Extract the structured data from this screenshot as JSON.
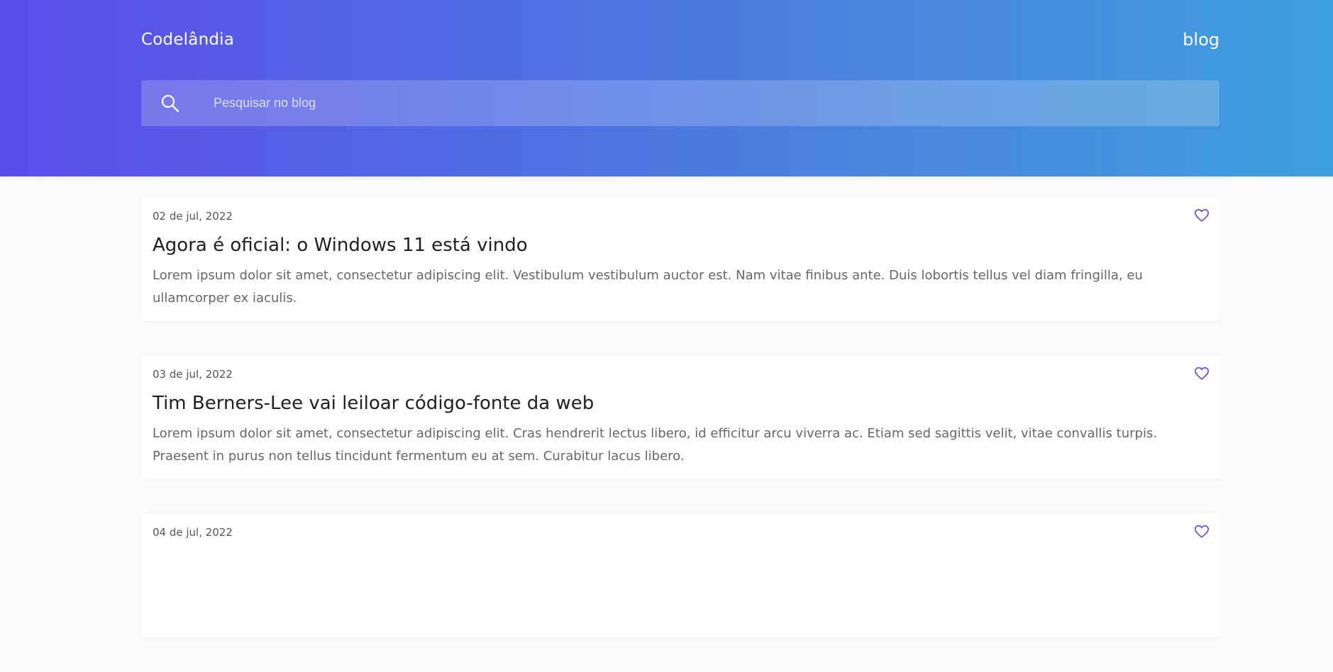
{
  "header": {
    "brand": "Codelândia",
    "nav_blog": "blog"
  },
  "search": {
    "placeholder": "Pesquisar no blog",
    "value": ""
  },
  "colors": {
    "gradient_start": "#5b4dea",
    "gradient_end": "#3d9fdc",
    "heart_accent": "#5b4dea",
    "page_bg": "#f9f9f9"
  },
  "icons": {
    "search": "search-icon",
    "like": "heart-outline-icon"
  },
  "posts": [
    {
      "date": "02 de jul, 2022",
      "title": "Agora é oficial: o Windows 11 está vindo",
      "excerpt": "Lorem ipsum dolor sit amet, consectetur adipiscing elit. Vestibulum vestibulum auctor est. Nam vitae finibus ante. Duis lobortis tellus vel diam fringilla, eu ullamcorper ex iaculis."
    },
    {
      "date": "03 de jul, 2022",
      "title": "Tim Berners-Lee vai leiloar código-fonte da web",
      "excerpt": "Lorem ipsum dolor sit amet, consectetur adipiscing elit. Cras hendrerit lectus libero, id efficitur arcu viverra ac. Etiam sed sagittis velit, vitae convallis turpis. Praesent in purus non tellus tincidunt fermentum eu at sem. Curabitur lacus libero."
    },
    {
      "date": "04 de jul, 2022",
      "title": "",
      "excerpt": ""
    }
  ]
}
